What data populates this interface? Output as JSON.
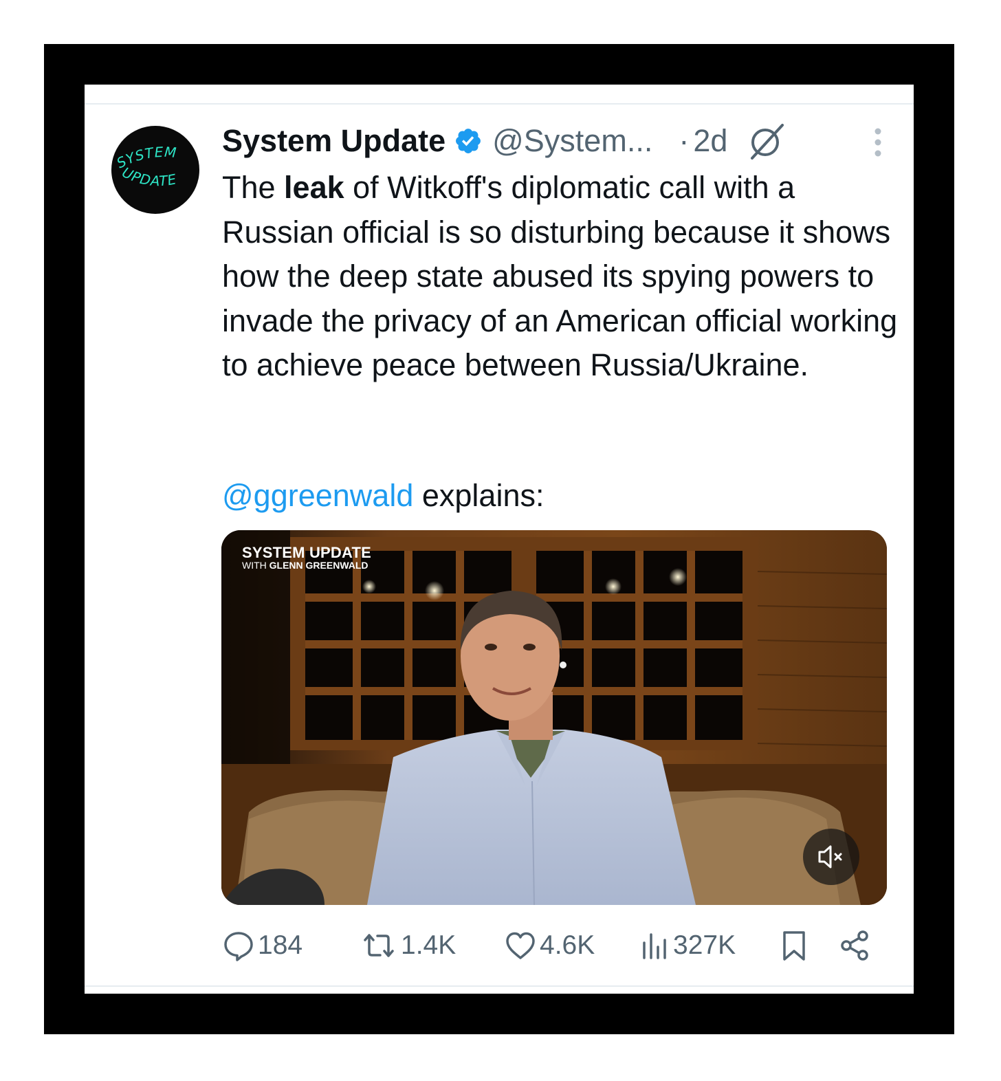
{
  "tweet": {
    "avatar_text": [
      "SYSTEM",
      "UPDATE"
    ],
    "author_name": "System Update",
    "handle": "@System...",
    "separator": "·",
    "time": "2d",
    "text_before_bold": "The ",
    "text_bold": "leak",
    "text_after_bold": " of Witkoff's diplomatic call with a Russian official is so disturbing because it shows how the deep state abused its spying powers to invade the privacy of an American official working to achieve peace between Russia/Ukraine.",
    "mention": "@ggreenwald",
    "mention_suffix": " explains:"
  },
  "media": {
    "overlay_title": "SYSTEM UPDATE",
    "overlay_sub_prefix": "WITH ",
    "overlay_sub_name": "GLENN GREENWALD",
    "muted": true
  },
  "actions": {
    "replies": "184",
    "reposts": "1.4K",
    "likes": "4.6K",
    "views": "327K"
  },
  "icons": [
    "verified-badge-icon",
    "grok-icon",
    "more-icon",
    "mute-icon",
    "reply-icon",
    "repost-icon",
    "like-icon",
    "views-icon",
    "bookmark-icon",
    "share-icon"
  ],
  "colors": {
    "frame": "#000000",
    "text": "#0f1419",
    "secondary": "#536471",
    "accent": "#1d9bf0",
    "avatar_text": "#2ee6c7"
  }
}
